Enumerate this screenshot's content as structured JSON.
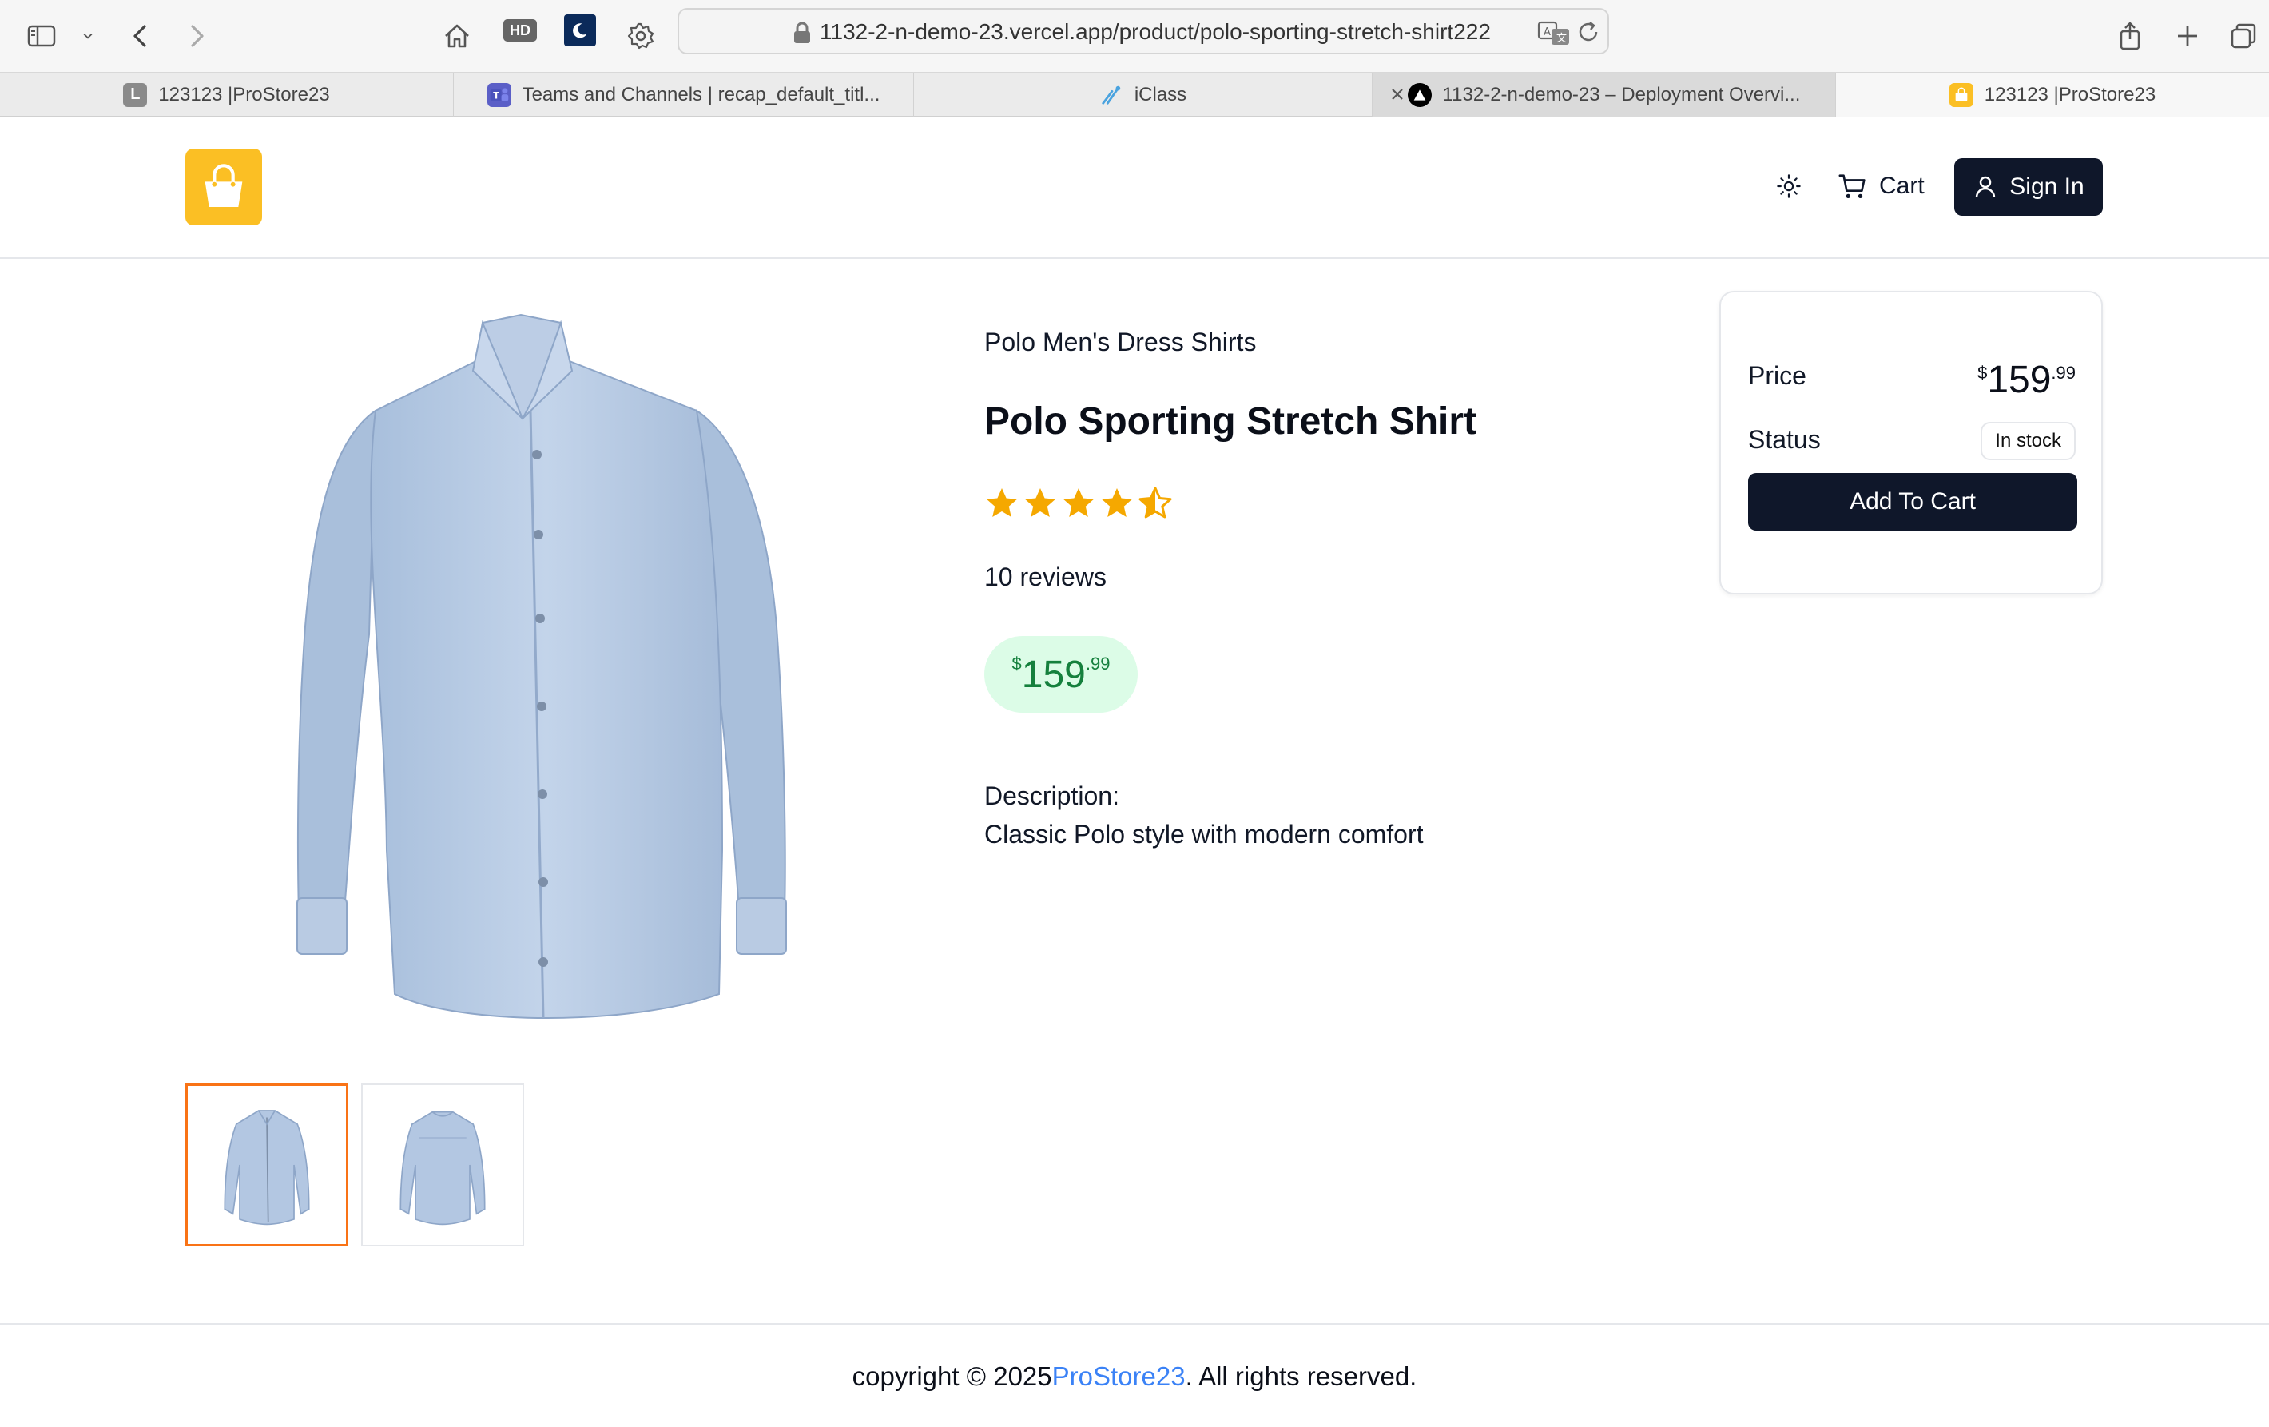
{
  "browser": {
    "url": "1132-2-n-demo-23.vercel.app/product/polo-sporting-stretch-shirt222",
    "hd_label": "HD",
    "tabs": [
      {
        "title": "123123 |ProStore23",
        "favicon_letter": "L"
      },
      {
        "title": "Teams and Channels | recap_default_titl..."
      },
      {
        "title": "iClass"
      },
      {
        "title": "1132-2-n-demo-23 – Deployment Overvi..."
      },
      {
        "title": "123123 |ProStore23"
      }
    ]
  },
  "header": {
    "cart_label": "Cart",
    "signin_label": "Sign In",
    "logo_color": "#fbbf24"
  },
  "product": {
    "brand": "Polo Men's Dress Shirts",
    "name": "Polo Sporting Stretch Shirt",
    "rating": 4.5,
    "rating_max": 5,
    "reviews_text": "10 reviews",
    "price": {
      "symbol": "$",
      "integer": "159",
      "decimal": ".99"
    },
    "description_label": "Description:",
    "description": "Classic Polo style with modern comfort",
    "thumbnails": [
      "shirt-front",
      "shirt-back"
    ],
    "selected_thumbnail": 0
  },
  "price_card": {
    "price_label": "Price",
    "status_label": "Status",
    "status_value": "In stock",
    "add_to_cart_label": "Add To Cart"
  },
  "footer": {
    "prefix": "copyright © 2025",
    "brand": "ProStore23",
    "suffix": ". All rights reserved."
  },
  "colors": {
    "accent_dark": "#0f172a",
    "star": "#f5a800",
    "price_pill_bg": "#dcfce7",
    "price_pill_text": "#15803d",
    "thumb_selected": "#f97316",
    "footer_link": "#3b82f6"
  }
}
